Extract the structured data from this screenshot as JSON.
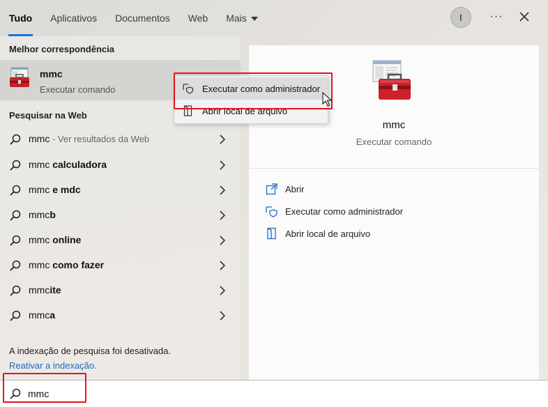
{
  "tabs": [
    {
      "label": "Tudo",
      "active": true
    },
    {
      "label": "Aplicativos",
      "active": false
    },
    {
      "label": "Documentos",
      "active": false
    },
    {
      "label": "Web",
      "active": false
    },
    {
      "label": "Mais",
      "active": false
    }
  ],
  "header": {
    "avatar_letter": "I",
    "more_label": "···"
  },
  "best_match": {
    "section": "Melhor correspondência",
    "name": "mmc",
    "subtitle": "Executar comando"
  },
  "web": {
    "section": "Pesquisar na Web",
    "items": [
      {
        "prefix": "mmc",
        "bold": "",
        "muted": " - Ver resultados da Web"
      },
      {
        "prefix": "mmc ",
        "bold": "calculadora",
        "muted": ""
      },
      {
        "prefix": "mmc ",
        "bold": "e mdc",
        "muted": ""
      },
      {
        "prefix": "mmc",
        "bold": "b",
        "muted": ""
      },
      {
        "prefix": "mmc ",
        "bold": "online",
        "muted": ""
      },
      {
        "prefix": "mmc ",
        "bold": "como fazer",
        "muted": ""
      },
      {
        "prefix": "mmc",
        "bold": "ite",
        "muted": ""
      },
      {
        "prefix": "mmc",
        "bold": "a",
        "muted": ""
      }
    ]
  },
  "indexing": {
    "note": "A indexação de pesquisa foi desativada.",
    "link": "Reativar a indexação."
  },
  "detail": {
    "name": "mmc",
    "subtitle": "Executar comando",
    "actions": [
      {
        "label": "Abrir",
        "icon": "open-icon"
      },
      {
        "label": "Executar como administrador",
        "icon": "shield-icon"
      },
      {
        "label": "Abrir local de arquivo",
        "icon": "file-location-icon"
      }
    ]
  },
  "context_menu": {
    "items": [
      {
        "label": "Executar como administrador",
        "icon": "shield-icon"
      },
      {
        "label": "Abrir local de arquivo",
        "icon": "file-location-icon"
      }
    ]
  },
  "search": {
    "value": "mmc"
  },
  "colors": {
    "accent": "#1a73d9",
    "highlight_box": "#e0141e",
    "link": "#1a6bbd"
  }
}
